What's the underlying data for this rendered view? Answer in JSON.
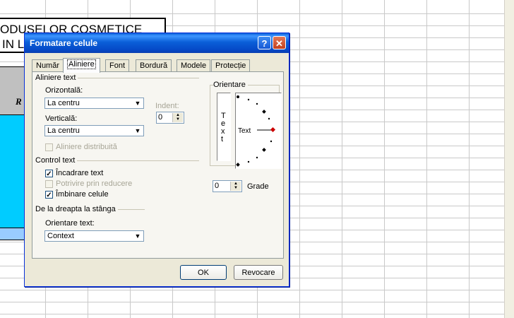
{
  "sheet": {
    "title_line1": "ODUSELOR COSMETICE",
    "title_line2": "IN L",
    "col_header_text": "R"
  },
  "dialog": {
    "title": "Formatare celule",
    "help_label": "?",
    "close_label": "✕",
    "tabs": [
      "Număr",
      "Aliniere",
      "Font",
      "Bordură",
      "Modele",
      "Protecție"
    ],
    "active_tab": "Aliniere",
    "text_alignment": {
      "group_label": "Aliniere text",
      "horizontal_label": "Orizontală:",
      "horizontal_value": "La centru",
      "vertical_label": "Verticală:",
      "vertical_value": "La centru",
      "indent_label": "Indent:",
      "indent_value": "0",
      "distributed_label": "Aliniere distribuită",
      "distributed_checked": false
    },
    "text_control": {
      "group_label": "Control text",
      "wrap_label": "Încadrare text",
      "wrap_checked": true,
      "shrink_label": "Potrivire prin reducere",
      "shrink_checked": false,
      "merge_label": "Îmbinare celule",
      "merge_checked": true
    },
    "rtl": {
      "group_label": "De la dreapta la stânga",
      "direction_label": "Orientare text:",
      "direction_value": "Context"
    },
    "orientation": {
      "group_label": "Orientare",
      "vertical_letters": [
        "T",
        "e",
        "x",
        "t"
      ],
      "dial_text": "Text",
      "degrees_value": "0",
      "degrees_label": "Grade"
    },
    "ok_label": "OK",
    "cancel_label": "Revocare"
  },
  "colors": {
    "header_fill": "#c0c0c0",
    "cell_fill": "#00ccff",
    "row_fill": "#99ccff",
    "titlebar": "#0a5fd8",
    "dial_marker": "#cc0000"
  }
}
